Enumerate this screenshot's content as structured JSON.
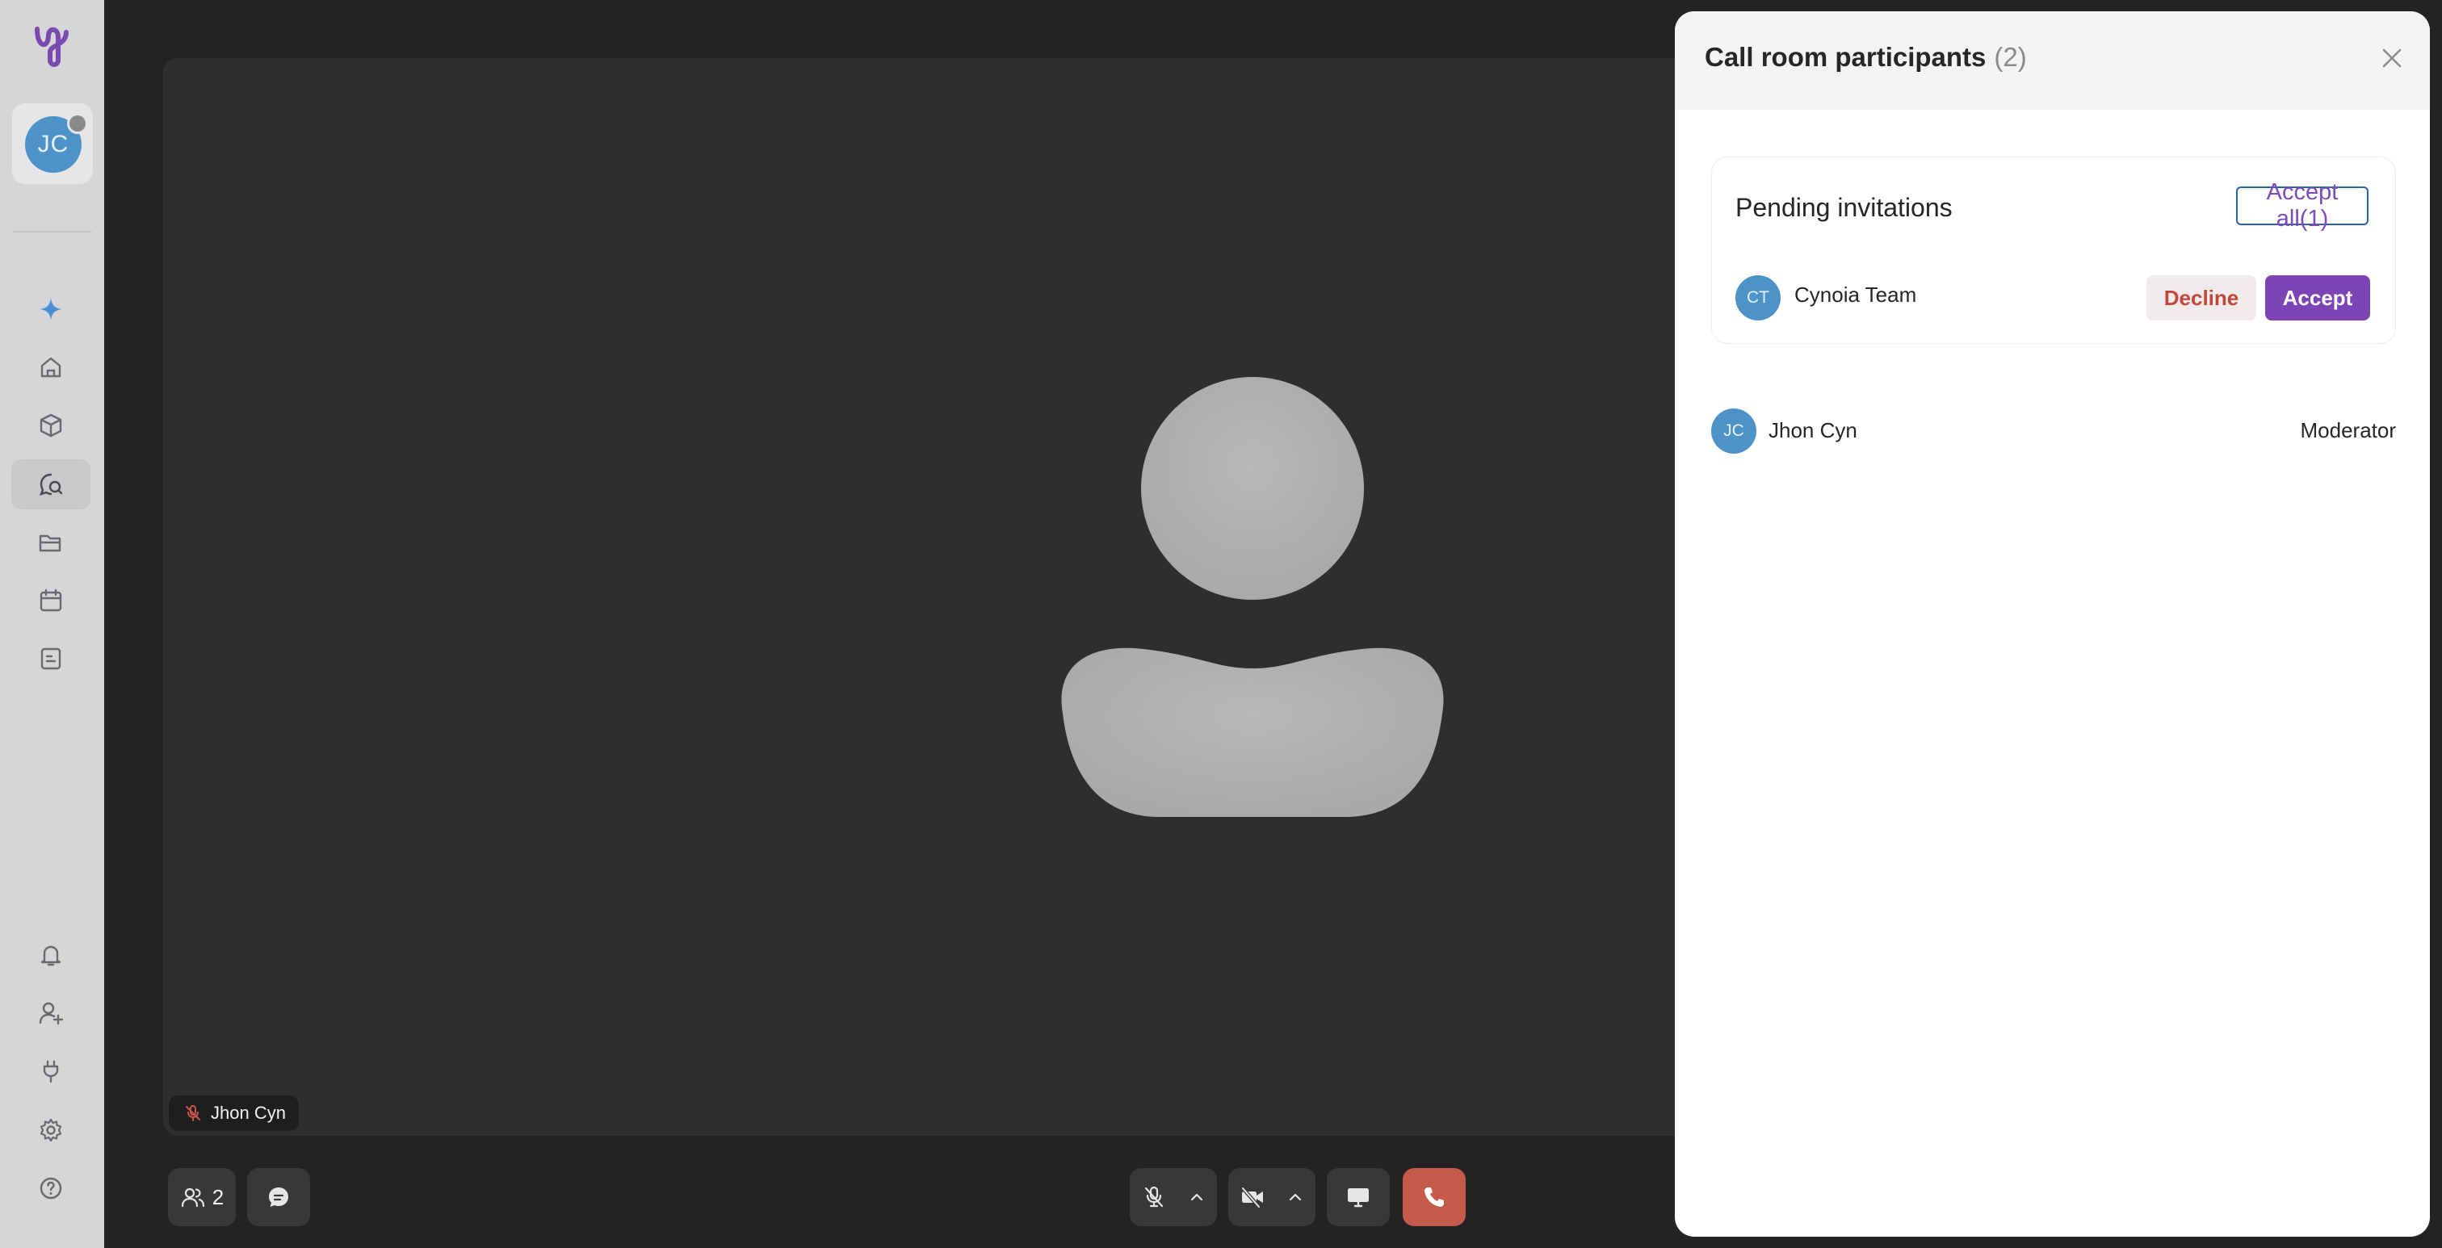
{
  "sidebar": {
    "user": {
      "initials": "JC"
    },
    "nav": [
      {
        "name": "ai",
        "icon": "sparkle-icon"
      },
      {
        "name": "home",
        "icon": "home-icon"
      },
      {
        "name": "projects",
        "icon": "cube-icon"
      },
      {
        "name": "meetings",
        "icon": "chat-search-icon",
        "active": true
      },
      {
        "name": "files",
        "icon": "folder-icon"
      },
      {
        "name": "calendar",
        "icon": "calendar-icon"
      },
      {
        "name": "notes",
        "icon": "document-icon"
      }
    ],
    "bottom_nav": [
      {
        "name": "notifications",
        "icon": "bell-icon"
      },
      {
        "name": "invite-user",
        "icon": "user-plus-icon"
      },
      {
        "name": "integrations",
        "icon": "plug-icon"
      },
      {
        "name": "settings",
        "icon": "gear-icon"
      },
      {
        "name": "help",
        "icon": "help-icon"
      }
    ]
  },
  "video": {
    "participant_label": "Jhon Cyn",
    "muted": true
  },
  "controls": {
    "participants_count": "2",
    "items": [
      {
        "name": "participants",
        "icon": "users-icon"
      },
      {
        "name": "chat",
        "icon": "chat-icon"
      },
      {
        "name": "microphone",
        "icon": "mic-off-icon"
      },
      {
        "name": "camera",
        "icon": "video-off-icon"
      },
      {
        "name": "screen-share",
        "icon": "monitor-icon"
      },
      {
        "name": "end-call",
        "icon": "phone-icon"
      }
    ]
  },
  "panel": {
    "title": "Call room participants",
    "count": "(2)",
    "pending": {
      "title": "Pending invitations",
      "accept_all_label": "Accept all(1)",
      "invitees": [
        {
          "initials": "CT",
          "name": "Cynoia Team",
          "decline_label": "Decline",
          "accept_label": "Accept"
        }
      ]
    },
    "participants": [
      {
        "initials": "JC",
        "name": "Jhon Cyn",
        "role": "Moderator"
      }
    ]
  },
  "colors": {
    "accent_purple": "#7d44b6",
    "decline_red": "#c0473a",
    "end_call": "#c65a48",
    "avatar_blue": "#4d93c7"
  }
}
